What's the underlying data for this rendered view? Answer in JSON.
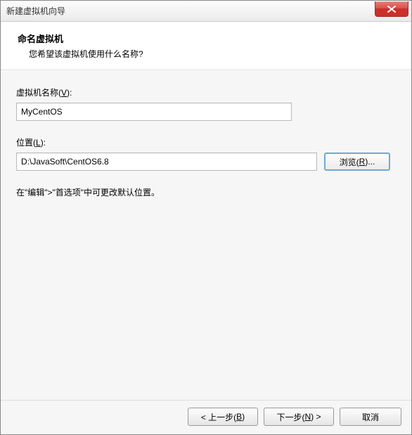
{
  "window": {
    "title": "新建虚拟机向导"
  },
  "header": {
    "title": "命名虚拟机",
    "subtitle": "您希望该虚拟机使用什么名称?"
  },
  "fields": {
    "name_label_pre": "虚拟机名称(",
    "name_hotkey": "V",
    "name_label_post": "):",
    "name_value": "MyCentOS",
    "location_label_pre": "位置(",
    "location_hotkey": "L",
    "location_label_post": "):",
    "location_value": "D:\\JavaSoft\\CentOS6.8",
    "browse_pre": "浏览(",
    "browse_hotkey": "R",
    "browse_post": ")..."
  },
  "hint": "在\"编辑\">\"首选项\"中可更改默认位置。",
  "footer": {
    "back_pre": "< 上一步(",
    "back_hotkey": "B",
    "back_post": ")",
    "next_pre": "下一步(",
    "next_hotkey": "N",
    "next_post": ") >",
    "cancel": "取消"
  }
}
